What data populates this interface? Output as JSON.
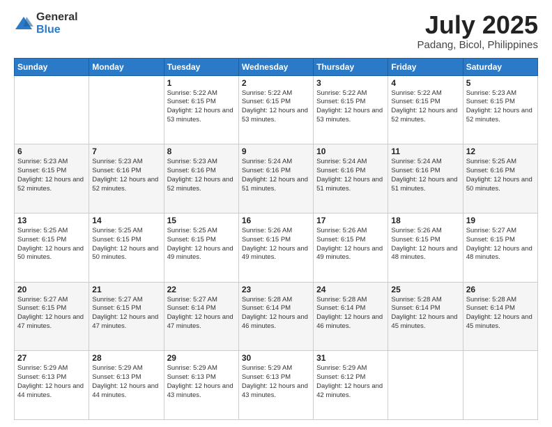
{
  "header": {
    "logo_line1": "General",
    "logo_line2": "Blue",
    "month_year": "July 2025",
    "location": "Padang, Bicol, Philippines"
  },
  "weekdays": [
    "Sunday",
    "Monday",
    "Tuesday",
    "Wednesday",
    "Thursday",
    "Friday",
    "Saturday"
  ],
  "weeks": [
    [
      {
        "day": "",
        "sunrise": "",
        "sunset": "",
        "daylight": ""
      },
      {
        "day": "",
        "sunrise": "",
        "sunset": "",
        "daylight": ""
      },
      {
        "day": "1",
        "sunrise": "Sunrise: 5:22 AM",
        "sunset": "Sunset: 6:15 PM",
        "daylight": "Daylight: 12 hours and 53 minutes."
      },
      {
        "day": "2",
        "sunrise": "Sunrise: 5:22 AM",
        "sunset": "Sunset: 6:15 PM",
        "daylight": "Daylight: 12 hours and 53 minutes."
      },
      {
        "day": "3",
        "sunrise": "Sunrise: 5:22 AM",
        "sunset": "Sunset: 6:15 PM",
        "daylight": "Daylight: 12 hours and 53 minutes."
      },
      {
        "day": "4",
        "sunrise": "Sunrise: 5:22 AM",
        "sunset": "Sunset: 6:15 PM",
        "daylight": "Daylight: 12 hours and 52 minutes."
      },
      {
        "day": "5",
        "sunrise": "Sunrise: 5:23 AM",
        "sunset": "Sunset: 6:15 PM",
        "daylight": "Daylight: 12 hours and 52 minutes."
      }
    ],
    [
      {
        "day": "6",
        "sunrise": "Sunrise: 5:23 AM",
        "sunset": "Sunset: 6:15 PM",
        "daylight": "Daylight: 12 hours and 52 minutes."
      },
      {
        "day": "7",
        "sunrise": "Sunrise: 5:23 AM",
        "sunset": "Sunset: 6:16 PM",
        "daylight": "Daylight: 12 hours and 52 minutes."
      },
      {
        "day": "8",
        "sunrise": "Sunrise: 5:23 AM",
        "sunset": "Sunset: 6:16 PM",
        "daylight": "Daylight: 12 hours and 52 minutes."
      },
      {
        "day": "9",
        "sunrise": "Sunrise: 5:24 AM",
        "sunset": "Sunset: 6:16 PM",
        "daylight": "Daylight: 12 hours and 51 minutes."
      },
      {
        "day": "10",
        "sunrise": "Sunrise: 5:24 AM",
        "sunset": "Sunset: 6:16 PM",
        "daylight": "Daylight: 12 hours and 51 minutes."
      },
      {
        "day": "11",
        "sunrise": "Sunrise: 5:24 AM",
        "sunset": "Sunset: 6:16 PM",
        "daylight": "Daylight: 12 hours and 51 minutes."
      },
      {
        "day": "12",
        "sunrise": "Sunrise: 5:25 AM",
        "sunset": "Sunset: 6:16 PM",
        "daylight": "Daylight: 12 hours and 50 minutes."
      }
    ],
    [
      {
        "day": "13",
        "sunrise": "Sunrise: 5:25 AM",
        "sunset": "Sunset: 6:15 PM",
        "daylight": "Daylight: 12 hours and 50 minutes."
      },
      {
        "day": "14",
        "sunrise": "Sunrise: 5:25 AM",
        "sunset": "Sunset: 6:15 PM",
        "daylight": "Daylight: 12 hours and 50 minutes."
      },
      {
        "day": "15",
        "sunrise": "Sunrise: 5:25 AM",
        "sunset": "Sunset: 6:15 PM",
        "daylight": "Daylight: 12 hours and 49 minutes."
      },
      {
        "day": "16",
        "sunrise": "Sunrise: 5:26 AM",
        "sunset": "Sunset: 6:15 PM",
        "daylight": "Daylight: 12 hours and 49 minutes."
      },
      {
        "day": "17",
        "sunrise": "Sunrise: 5:26 AM",
        "sunset": "Sunset: 6:15 PM",
        "daylight": "Daylight: 12 hours and 49 minutes."
      },
      {
        "day": "18",
        "sunrise": "Sunrise: 5:26 AM",
        "sunset": "Sunset: 6:15 PM",
        "daylight": "Daylight: 12 hours and 48 minutes."
      },
      {
        "day": "19",
        "sunrise": "Sunrise: 5:27 AM",
        "sunset": "Sunset: 6:15 PM",
        "daylight": "Daylight: 12 hours and 48 minutes."
      }
    ],
    [
      {
        "day": "20",
        "sunrise": "Sunrise: 5:27 AM",
        "sunset": "Sunset: 6:15 PM",
        "daylight": "Daylight: 12 hours and 47 minutes."
      },
      {
        "day": "21",
        "sunrise": "Sunrise: 5:27 AM",
        "sunset": "Sunset: 6:15 PM",
        "daylight": "Daylight: 12 hours and 47 minutes."
      },
      {
        "day": "22",
        "sunrise": "Sunrise: 5:27 AM",
        "sunset": "Sunset: 6:14 PM",
        "daylight": "Daylight: 12 hours and 47 minutes."
      },
      {
        "day": "23",
        "sunrise": "Sunrise: 5:28 AM",
        "sunset": "Sunset: 6:14 PM",
        "daylight": "Daylight: 12 hours and 46 minutes."
      },
      {
        "day": "24",
        "sunrise": "Sunrise: 5:28 AM",
        "sunset": "Sunset: 6:14 PM",
        "daylight": "Daylight: 12 hours and 46 minutes."
      },
      {
        "day": "25",
        "sunrise": "Sunrise: 5:28 AM",
        "sunset": "Sunset: 6:14 PM",
        "daylight": "Daylight: 12 hours and 45 minutes."
      },
      {
        "day": "26",
        "sunrise": "Sunrise: 5:28 AM",
        "sunset": "Sunset: 6:14 PM",
        "daylight": "Daylight: 12 hours and 45 minutes."
      }
    ],
    [
      {
        "day": "27",
        "sunrise": "Sunrise: 5:29 AM",
        "sunset": "Sunset: 6:13 PM",
        "daylight": "Daylight: 12 hours and 44 minutes."
      },
      {
        "day": "28",
        "sunrise": "Sunrise: 5:29 AM",
        "sunset": "Sunset: 6:13 PM",
        "daylight": "Daylight: 12 hours and 44 minutes."
      },
      {
        "day": "29",
        "sunrise": "Sunrise: 5:29 AM",
        "sunset": "Sunset: 6:13 PM",
        "daylight": "Daylight: 12 hours and 43 minutes."
      },
      {
        "day": "30",
        "sunrise": "Sunrise: 5:29 AM",
        "sunset": "Sunset: 6:13 PM",
        "daylight": "Daylight: 12 hours and 43 minutes."
      },
      {
        "day": "31",
        "sunrise": "Sunrise: 5:29 AM",
        "sunset": "Sunset: 6:12 PM",
        "daylight": "Daylight: 12 hours and 42 minutes."
      },
      {
        "day": "",
        "sunrise": "",
        "sunset": "",
        "daylight": ""
      },
      {
        "day": "",
        "sunrise": "",
        "sunset": "",
        "daylight": ""
      }
    ]
  ]
}
